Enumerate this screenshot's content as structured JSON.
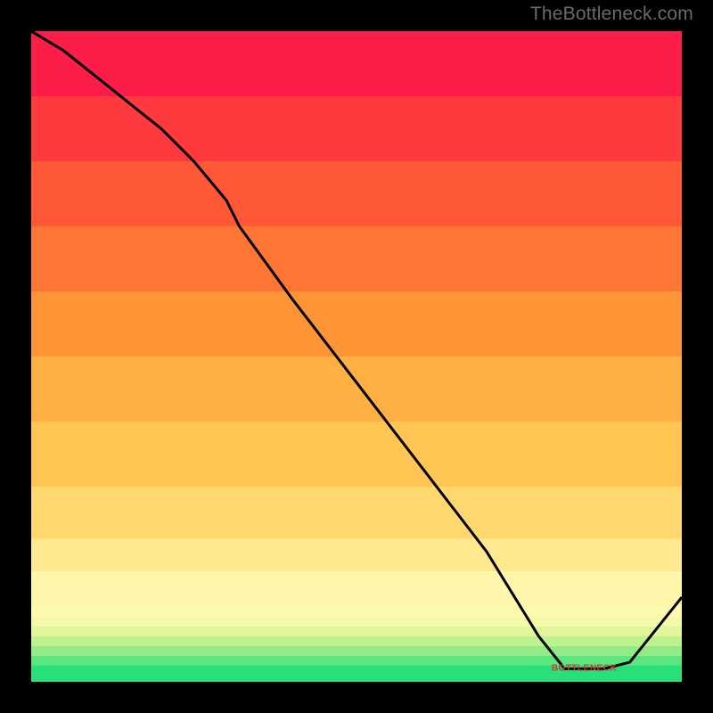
{
  "attribution": "TheBottleneck.com",
  "chart_data": {
    "type": "line",
    "x": [
      0.0,
      0.05,
      0.1,
      0.15,
      0.2,
      0.25,
      0.3,
      0.32,
      0.4,
      0.5,
      0.6,
      0.7,
      0.78,
      0.82,
      0.88,
      0.92,
      1.0
    ],
    "values": [
      1.0,
      0.97,
      0.93,
      0.89,
      0.85,
      0.8,
      0.74,
      0.7,
      0.59,
      0.46,
      0.33,
      0.2,
      0.07,
      0.02,
      0.02,
      0.03,
      0.13
    ],
    "title": "",
    "xlabel": "",
    "ylabel": "",
    "xlim": [
      0,
      1
    ],
    "ylim": [
      0,
      1
    ],
    "grid": false,
    "legend": false,
    "bottleneck_marker": {
      "x": 0.85,
      "y": 0.02,
      "label": "BOTTLENECK"
    },
    "background_bands": [
      {
        "from": 0.0,
        "to": 0.025,
        "color": "#27e07a"
      },
      {
        "from": 0.025,
        "to": 0.04,
        "color": "#5de57f"
      },
      {
        "from": 0.04,
        "to": 0.055,
        "color": "#92eb86"
      },
      {
        "from": 0.055,
        "to": 0.07,
        "color": "#c0f18f"
      },
      {
        "from": 0.07,
        "to": 0.085,
        "color": "#e3f69b"
      },
      {
        "from": 0.085,
        "to": 0.1,
        "color": "#f4faaa"
      },
      {
        "from": 0.1,
        "to": 0.12,
        "color": "#fdfab0"
      },
      {
        "from": 0.12,
        "to": 0.17,
        "color": "#fff6ab"
      },
      {
        "from": 0.17,
        "to": 0.22,
        "color": "#ffe88f"
      },
      {
        "from": 0.22,
        "to": 0.3,
        "color": "#ffd96f"
      },
      {
        "from": 0.3,
        "to": 0.4,
        "color": "#ffc654"
      },
      {
        "from": 0.4,
        "to": 0.5,
        "color": "#ffb042"
      },
      {
        "from": 0.5,
        "to": 0.6,
        "color": "#ff9437"
      },
      {
        "from": 0.6,
        "to": 0.7,
        "color": "#ff7634"
      },
      {
        "from": 0.7,
        "to": 0.8,
        "color": "#ff5837"
      },
      {
        "from": 0.8,
        "to": 0.9,
        "color": "#ff3a3f"
      },
      {
        "from": 0.9,
        "to": 1.0,
        "color": "#fc1e48"
      }
    ],
    "line_color": "#000000"
  }
}
